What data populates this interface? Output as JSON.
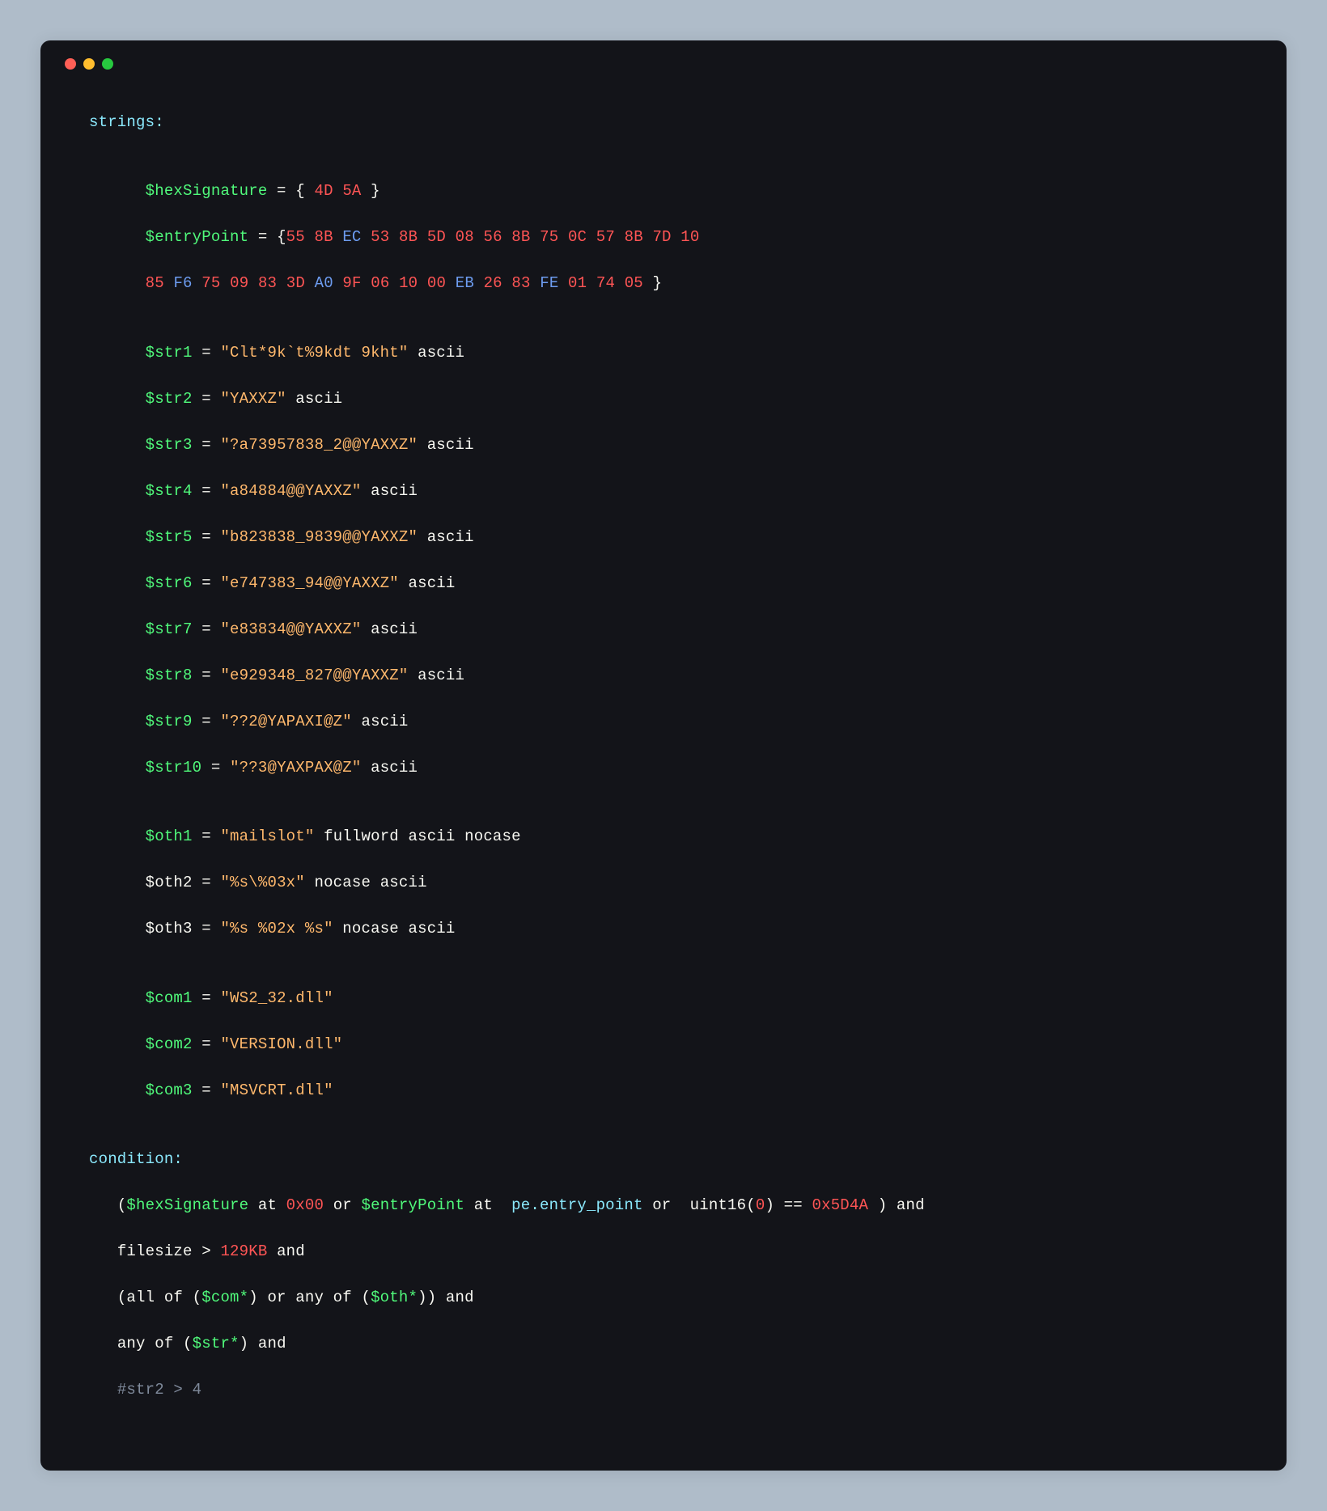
{
  "section": {
    "strings": "strings:",
    "condition": "condition:"
  },
  "eq": " = ",
  "hexSig": {
    "name": "$hexSignature",
    "open": "{ ",
    "b1": "4D",
    "b2": "5A",
    "close": " }"
  },
  "entry": {
    "name": "$entryPoint",
    "open": "{",
    "h_55": "55",
    "h_8B": "8B",
    "h_EC": "EC",
    "h_53": "53",
    "h_5D": "5D",
    "h_08": "08",
    "h_56": "56",
    "h_75": "75",
    "h_0C": "0C",
    "h_57": "57",
    "h_7D": "7D",
    "h_10": "10",
    "h_85": "85",
    "h_F6": "F6",
    "h_09": "09",
    "h_83": "83",
    "h_3D": "3D",
    "h_A0": "A0",
    "h_9F": "9F",
    "h_06": "06",
    "h_00": "00",
    "h_EB": "EB",
    "h_26": "26",
    "h_FE": "FE",
    "h_01": "01",
    "h_74": "74",
    "h_05": "05",
    "close": " }"
  },
  "strdefs": {
    "s1": {
      "name": "$str1",
      "val": "\"Clt*9k`t%9kdt 9kht\"",
      "mods": " ascii"
    },
    "s2": {
      "name": "$str2",
      "val": "\"YAXXZ\"",
      "mods": " ascii"
    },
    "s3": {
      "name": "$str3",
      "val": "\"?a73957838_2@@YAXXZ\"",
      "mods": " ascii"
    },
    "s4": {
      "name": "$str4",
      "val": "\"a84884@@YAXXZ\"",
      "mods": " ascii"
    },
    "s5": {
      "name": "$str5",
      "val": "\"b823838_9839@@YAXXZ\"",
      "mods": " ascii"
    },
    "s6": {
      "name": "$str6",
      "val": "\"e747383_94@@YAXXZ\"",
      "mods": " ascii"
    },
    "s7": {
      "name": "$str7",
      "val": "\"e83834@@YAXXZ\"",
      "mods": " ascii"
    },
    "s8": {
      "name": "$str8",
      "val": "\"e929348_827@@YAXXZ\"",
      "mods": " ascii"
    },
    "s9": {
      "name": "$str9",
      "val": "\"??2@YAPAXI@Z\"",
      "mods": " ascii"
    },
    "s10": {
      "name": "$str10",
      "val": "\"??3@YAXPAX@Z\"",
      "mods": " ascii"
    }
  },
  "oth": {
    "o1": {
      "name": "$oth1",
      "val": "\"mailslot\"",
      "mods": " fullword ascii nocase"
    },
    "o2": {
      "name": "$oth2",
      "val": "\"%s\\%03x\"",
      "mods": " nocase ascii"
    },
    "o3": {
      "name": "$oth3",
      "val": "\"%s %02x %s\"",
      "mods": " nocase ascii"
    }
  },
  "com": {
    "c1": {
      "name": "$com1",
      "val": "\"WS2_32.dll\""
    },
    "c2": {
      "name": "$com2",
      "val": "\"VERSION.dll\""
    },
    "c3": {
      "name": "$com3",
      "val": "\"MSVCRT.dll\""
    }
  },
  "cond": {
    "lparen": "(",
    "hexSig": "$hexSignature",
    "at": " at ",
    "zero_hex": "0x00",
    "or": " or ",
    "entry": "$entryPoint",
    "pe_entry": " pe.entry_point",
    "uint16": " uint16(",
    "uint16_arg": "0",
    "rparen_sp": ") ",
    "eqeq": "== ",
    "magic": "0x5D4A",
    "closeparen_and": " ) and",
    "filesize": "filesize ",
    "gt": "> ",
    "filesize_val": "129KB",
    "and": " and",
    "line3_a": "(all of (",
    "com_glob": "$com*",
    "line3_b": ") or any of (",
    "oth_glob": "$oth*",
    "line3_c": ")) and",
    "line4_a": "any of (",
    "str_glob": "$str*",
    "line4_b": ") and",
    "comment": "#str2 > 4"
  }
}
